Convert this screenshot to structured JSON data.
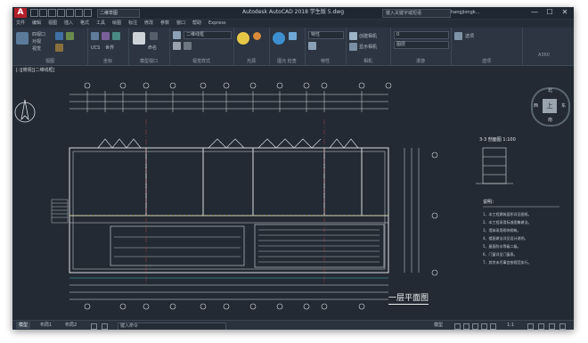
{
  "titlebar": {
    "logo": "A",
    "workspace": "二维草图",
    "title": "Autodesk AutoCAD 2018    学生版    5.dwg",
    "search_placeholder": "键入关键字或短语",
    "user": "hangjiongk...",
    "controls": [
      "—",
      "☐",
      "✕"
    ]
  },
  "menu": [
    "文件",
    "编辑",
    "视图",
    "插入",
    "格式",
    "工具",
    "绘图",
    "标注",
    "修改",
    "参数",
    "窗口",
    "帮助",
    "Express"
  ],
  "ribbon": {
    "panels": [
      {
        "label": "视图",
        "items": [
          "四视口",
          "对视",
          "视觉"
        ]
      },
      {
        "label": "坐标",
        "items": [
          "UCS",
          "世界"
        ]
      },
      {
        "label": "模型视口",
        "items": [
          "视口",
          "命名"
        ]
      },
      {
        "label": "视觉样式",
        "items": [
          "二维线框"
        ]
      },
      {
        "label": "光源",
        "items": [
          "光源"
        ]
      },
      {
        "label": "图元 检查",
        "items": [
          "检查"
        ]
      },
      {
        "label": "特性",
        "items": [
          "特性"
        ]
      },
      {
        "label": "相机",
        "items": [
          "创建相机",
          "显示相机"
        ]
      },
      {
        "label": "漫游",
        "items": [
          "漫游"
        ]
      },
      {
        "label": "选项",
        "items": [
          "选项",
          "图层"
        ]
      }
    ],
    "field_value": "二维线框",
    "layer_value": "0",
    "scale_value": "A360"
  },
  "viewport": {
    "label": "[-][俯视][二维线框]",
    "compass": {
      "n": "北",
      "s": "南",
      "e": "东",
      "w": "西",
      "center": "上"
    }
  },
  "drawing": {
    "plan_title": "一层平面图",
    "section_title": "3-3 剖面图 1:100",
    "notes_heading": "说明：",
    "notes": [
      "1、本工程建筑面积详见图纸。",
      "2、本工程采用标准图集做法。",
      "3、墙体采用砌块砌筑。",
      "4、楼面做法详见设计说明。",
      "5、屋面防水等级二级。",
      "6、门窗详见门窗表。",
      "7、其余未尽事宜按规范执行。"
    ]
  },
  "statusbar": {
    "tabs": [
      "模型",
      "布局1",
      "布局2"
    ],
    "cmd_placeholder": "键入命令",
    "coords": "模型",
    "scale": "1:1"
  },
  "colors": {
    "background": "#232a33",
    "line_white": "#d8dde2",
    "accent_yellow": "#d8c44a",
    "accent_cyan": "#47b7c7",
    "accent_red": "#c84848"
  }
}
